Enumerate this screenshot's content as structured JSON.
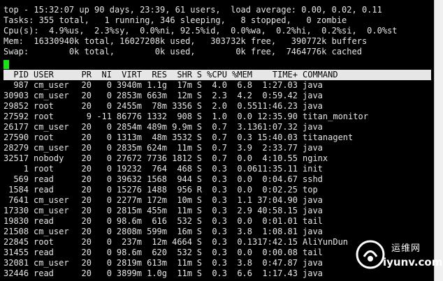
{
  "summary": [
    "top - 15:32:07 up 90 days, 23:39, 61 users,  load average: 0.00, 0.02, 0.11",
    "Tasks: 355 total,   1 running, 346 sleeping,   8 stopped,   0 zombie",
    "Cpu(s):  4.9%us,  2.3%sy,  0.0%ni, 92.5%id,  0.0%wa,  0.2%hi,  0.2%si,  0.0%st",
    "Mem:  16330940k total, 16027208k used,   303732k free,   390772k buffers",
    "Swap:        0k total,        0k used,        0k free,  7464776k cached"
  ],
  "columns": [
    "PID",
    "USER",
    "PR",
    "NI",
    "VIRT",
    "RES",
    "SHR",
    "S",
    "%CPU",
    "%MEM",
    "TIME+",
    "COMMAND"
  ],
  "processes": [
    [
      "987",
      "cm_user",
      "20",
      "0",
      "3940m",
      "1.1g",
      "17m",
      "S",
      "4.0",
      "6.8",
      "1:27.03",
      "java"
    ],
    [
      "30903",
      "cm_user",
      "20",
      "0",
      "2853m",
      "663m",
      "12m",
      "S",
      "2.3",
      "4.2",
      "0:59.42",
      "java"
    ],
    [
      "29852",
      "root",
      "20",
      "0",
      "2455m",
      "78m",
      "3356",
      "S",
      "2.0",
      "0.5",
      "511:46.23",
      "java"
    ],
    [
      "27592",
      "root",
      "9",
      "-11",
      "86776",
      "1332",
      "908",
      "S",
      "1.0",
      "0.0",
      "12:35.90",
      "titan_monitor"
    ],
    [
      "26177",
      "cm_user",
      "20",
      "0",
      "2854m",
      "489m",
      "9.9m",
      "S",
      "0.7",
      "3.1",
      "361:07.32",
      "java"
    ],
    [
      "27590",
      "root",
      "20",
      "0",
      "1313m",
      "48m",
      "3532",
      "S",
      "0.7",
      "0.3",
      "15:40.03",
      "titanagent"
    ],
    [
      "28279",
      "cm_user",
      "20",
      "0",
      "2835m",
      "624m",
      "11m",
      "S",
      "0.7",
      "3.9",
      "2:33.77",
      "java"
    ],
    [
      "32517",
      "nobody",
      "20",
      "0",
      "27672",
      "7736",
      "1812",
      "S",
      "0.7",
      "0.0",
      "4:10.55",
      "nginx"
    ],
    [
      "1",
      "root",
      "20",
      "0",
      "19232",
      "764",
      "468",
      "S",
      "0.3",
      "0.0",
      "611:35.11",
      "init"
    ],
    [
      "569",
      "read",
      "20",
      "0",
      "39632",
      "1568",
      "944",
      "S",
      "0.3",
      "0.0",
      "0:04.67",
      "sshd"
    ],
    [
      "1584",
      "read",
      "20",
      "0",
      "15276",
      "1488",
      "956",
      "R",
      "0.3",
      "0.0",
      "0:02.25",
      "top"
    ],
    [
      "7641",
      "cm_user",
      "20",
      "0",
      "2277m",
      "172m",
      "10m",
      "S",
      "0.3",
      "1.1",
      "37:04.90",
      "java"
    ],
    [
      "17330",
      "cm_user",
      "20",
      "0",
      "2815m",
      "455m",
      "11m",
      "S",
      "0.3",
      "2.9",
      "40:58.15",
      "java"
    ],
    [
      "19830",
      "read",
      "20",
      "0",
      "98.6m",
      "616",
      "532",
      "S",
      "0.3",
      "0.0",
      "0:01.01",
      "tail"
    ],
    [
      "21508",
      "cm_user",
      "20",
      "0",
      "2808m",
      "599m",
      "16m",
      "S",
      "0.3",
      "3.8",
      "1:08.81",
      "java"
    ],
    [
      "22845",
      "root",
      "20",
      "0",
      "237m",
      "12m",
      "4664",
      "S",
      "0.3",
      "0.1",
      "317:42.15",
      "AliYunDun"
    ],
    [
      "31455",
      "read",
      "20",
      "0",
      "98.6m",
      "620",
      "532",
      "S",
      "0.3",
      "0.0",
      "0:00.08",
      "tail"
    ],
    [
      "32081",
      "cm_user",
      "20",
      "0",
      "2819m",
      "613m",
      "11m",
      "S",
      "0.3",
      "3.8",
      "0:47.87",
      "java"
    ],
    [
      "32446",
      "read",
      "20",
      "0",
      "3899m",
      "1.0g",
      "11m",
      "S",
      "0.3",
      "6.6",
      "1:17.43",
      "java"
    ]
  ],
  "watermark": {
    "cn": "运维网",
    "url": "iyunv.com"
  },
  "colors": {
    "cursor": "#16e516",
    "header_bg": "#e6e6e6",
    "text": "#e6e6e6"
  }
}
